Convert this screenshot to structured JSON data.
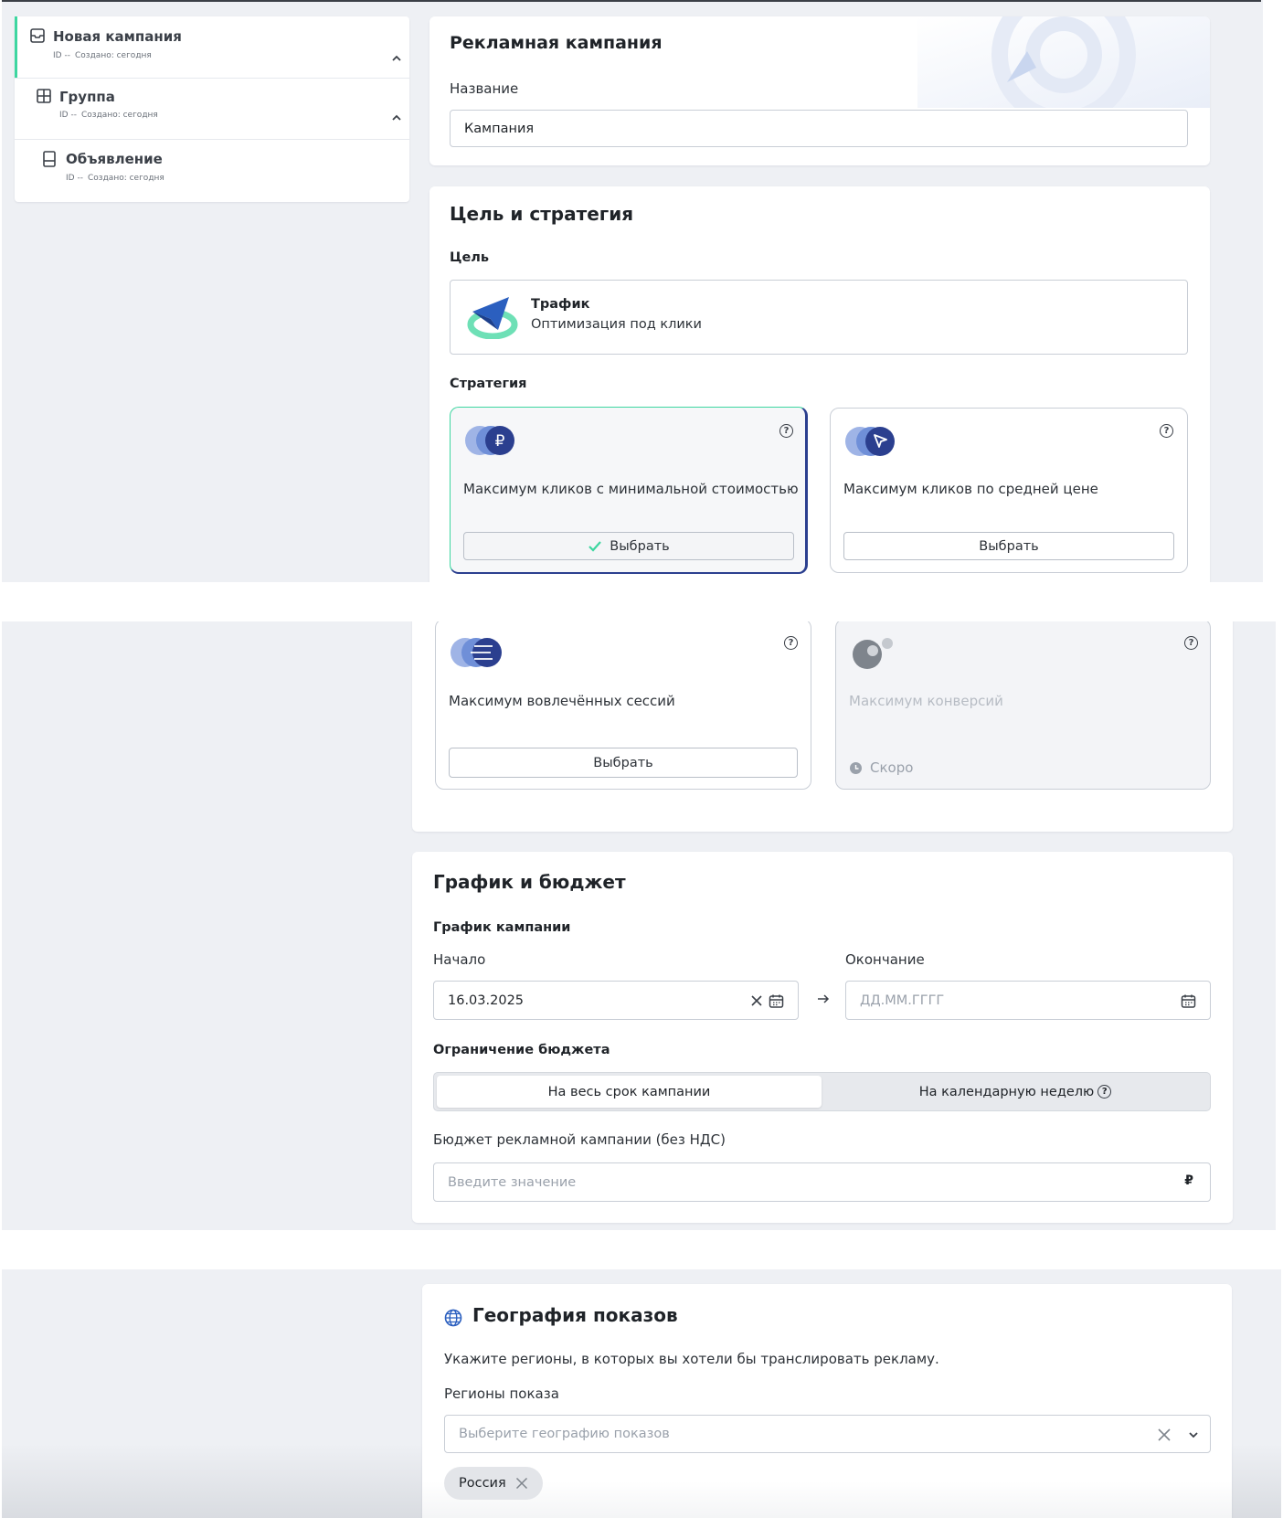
{
  "sidebar": {
    "items": [
      {
        "name": "Новая кампания",
        "id": "ID --",
        "created": "Создано: сегодня",
        "icon": "inbox-icon"
      },
      {
        "name": "Группа",
        "id": "ID --",
        "created": "Создано: сегодня",
        "icon": "grid-icon"
      },
      {
        "name": "Объявление",
        "id": "ID --",
        "created": "Создано: сегодня",
        "icon": "document-icon"
      }
    ]
  },
  "campaign": {
    "title": "Рекламная кампания",
    "name_label": "Название",
    "name_value": "Кампания"
  },
  "goal": {
    "title": "Цель и стратегия",
    "goal_label": "Цель",
    "goal_name": "Трафик",
    "goal_desc": "Оптимизация под клики",
    "strategy_label": "Стратегия",
    "strategies": [
      {
        "text": "Максимум кликов с минимальной стоимостью",
        "button": "Выбрать",
        "selected": true,
        "help": "?"
      },
      {
        "text": "Максимум кликов по средней цене",
        "button": "Выбрать",
        "selected": false,
        "help": "?"
      },
      {
        "text": "Максимум вовлечённых сессий",
        "button": "Выбрать",
        "selected": false,
        "help": "?"
      },
      {
        "text": "Максимум конверсий",
        "status": "Скоро",
        "disabled": true,
        "help": "?"
      }
    ]
  },
  "schedule": {
    "title": "График и бюджет",
    "section_label": "График кампании",
    "start_label": "Начало",
    "start_value": "16.03.2025",
    "end_label": "Окончание",
    "end_placeholder": "ДД.ММ.ГГГГ",
    "limit_label": "Ограничение бюджета",
    "tabs": [
      "На весь срок кампании",
      "На календарную неделю"
    ],
    "active_tab": 0,
    "budget_label": "Бюджет рекламной кампании (без НДС)",
    "budget_placeholder": "Введите значение",
    "currency": "₽"
  },
  "geo": {
    "title": "География показов",
    "description": "Укажите регионы, в которых вы хотели бы транслировать рекламу.",
    "regions_label": "Регионы показа",
    "regions_placeholder": "Выберите географию показов",
    "chips": [
      "Россия"
    ]
  },
  "colors": {
    "accent_green": "#3dd6a0",
    "brand_blue": "#2b3f8f",
    "light_blue": "#9fb4e6"
  }
}
